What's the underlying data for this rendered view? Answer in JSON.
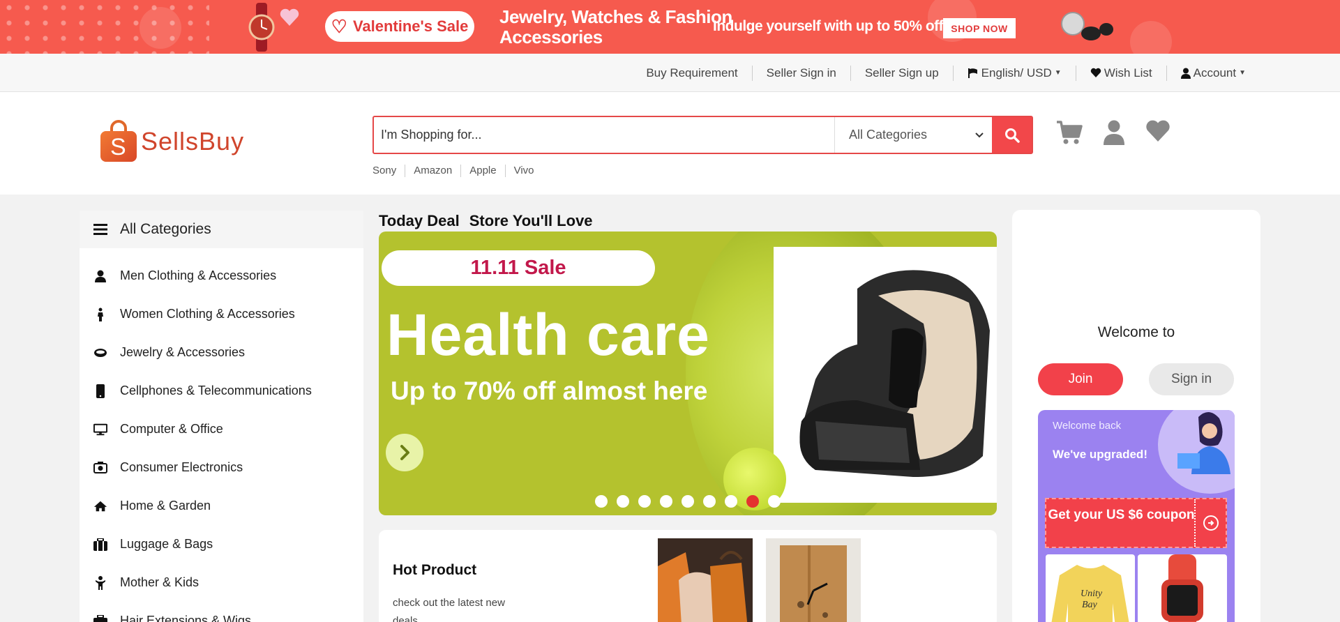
{
  "promo_banner": {
    "sale_pill": "Valentine's Sale",
    "headline_line1": "Jewelry, Watches & Fashion",
    "headline_line2": "Accessories",
    "offer": "Indulge yourself with up to 50% off",
    "cta": "SHOP NOW",
    "accent_color": "#f65a4e"
  },
  "topbar": {
    "links": [
      {
        "label": "Buy Requirement"
      },
      {
        "label": "Seller Sign in"
      },
      {
        "label": "Seller Sign up"
      },
      {
        "label": "English/ USD",
        "icon": "flag-icon"
      },
      {
        "label": "Wish List",
        "icon": "heart-icon"
      },
      {
        "label": "Account",
        "icon": "user-icon"
      }
    ]
  },
  "header": {
    "logo_letter": "S",
    "logo_text": "SellsBuy",
    "search": {
      "placeholder": "I'm Shopping for...",
      "category": "All Categories"
    },
    "suggestions": [
      "Sony",
      "Amazon",
      "Apple",
      "Vivo"
    ],
    "icons": [
      "cart-icon",
      "user-icon",
      "heart-icon"
    ]
  },
  "sidebar": {
    "title": "All Categories",
    "items": [
      {
        "label": "Men Clothing & Accessories",
        "icon": "user-icon"
      },
      {
        "label": "Women Clothing & Accessories",
        "icon": "female-icon"
      },
      {
        "label": "Jewelry & Accessories",
        "icon": "ring-icon"
      },
      {
        "label": "Cellphones & Telecommunications",
        "icon": "mobile-icon"
      },
      {
        "label": "Computer & Office",
        "icon": "desktop-icon"
      },
      {
        "label": "Consumer Electronics",
        "icon": "camera-icon"
      },
      {
        "label": "Home & Garden",
        "icon": "home-icon"
      },
      {
        "label": "Luggage & Bags",
        "icon": "suitcase-icon"
      },
      {
        "label": "Mother & Kids",
        "icon": "child-icon"
      },
      {
        "label": "Hair Extensions & Wigs",
        "icon": "briefcase-icon"
      }
    ]
  },
  "center": {
    "tabs": [
      "Today Deal",
      "Store You'll Love"
    ],
    "hero": {
      "pill": "11.11 Sale",
      "title": "Health care",
      "subtitle": "Up to 70% off almost here",
      "slide_count": 9,
      "active_slide": 8
    },
    "hot": {
      "title": "Hot Product",
      "text": "check out the latest new deals"
    }
  },
  "right_panel": {
    "welcome": "Welcome to",
    "join": "Join",
    "signin": "Sign in",
    "card": {
      "welcome_back": "Welcome back",
      "upgraded": "We've upgraded!",
      "coupon": "Get your US $6 coupon"
    }
  }
}
